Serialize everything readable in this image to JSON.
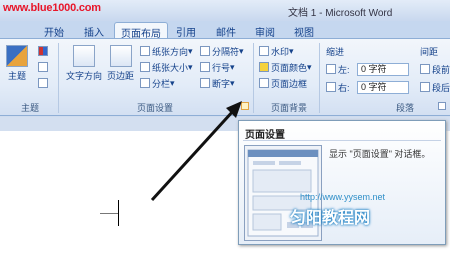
{
  "watermark": {
    "site": "www.blue1000.com",
    "url": "http://www.yysem.net",
    "brand": "匀阳教程网"
  },
  "window": {
    "title": "文档 1 - Microsoft Word"
  },
  "tabs": [
    "开始",
    "插入",
    "页面布局",
    "引用",
    "邮件",
    "审阅",
    "视图"
  ],
  "active_tab": "页面布局",
  "groups": {
    "theme": {
      "label": "主题",
      "theme_button": "主题"
    },
    "page_setup": {
      "label": "页面设置",
      "text_direction": "文字方向",
      "margins": "页边距",
      "orientation": "纸张方向",
      "size": "纸张大小",
      "columns": "分栏",
      "breaks": "分隔符",
      "line_numbers": "行号",
      "hyphenation": "断字"
    },
    "page_background": {
      "label": "页面背景",
      "watermark": "水印",
      "page_color": "页面颜色",
      "page_borders": "页面边框"
    },
    "paragraph": {
      "label": "段落",
      "indent_label": "缩进",
      "indent_left": "左:",
      "indent_left_value": "0 字符",
      "indent_right": "右:",
      "indent_right_value": "0 字符",
      "spacing_label": "间距",
      "spacing_before": "段前",
      "spacing_after": "段后"
    }
  },
  "tooltip": {
    "title": "页面设置",
    "description": "显示 \"页面设置\" 对话框。"
  }
}
